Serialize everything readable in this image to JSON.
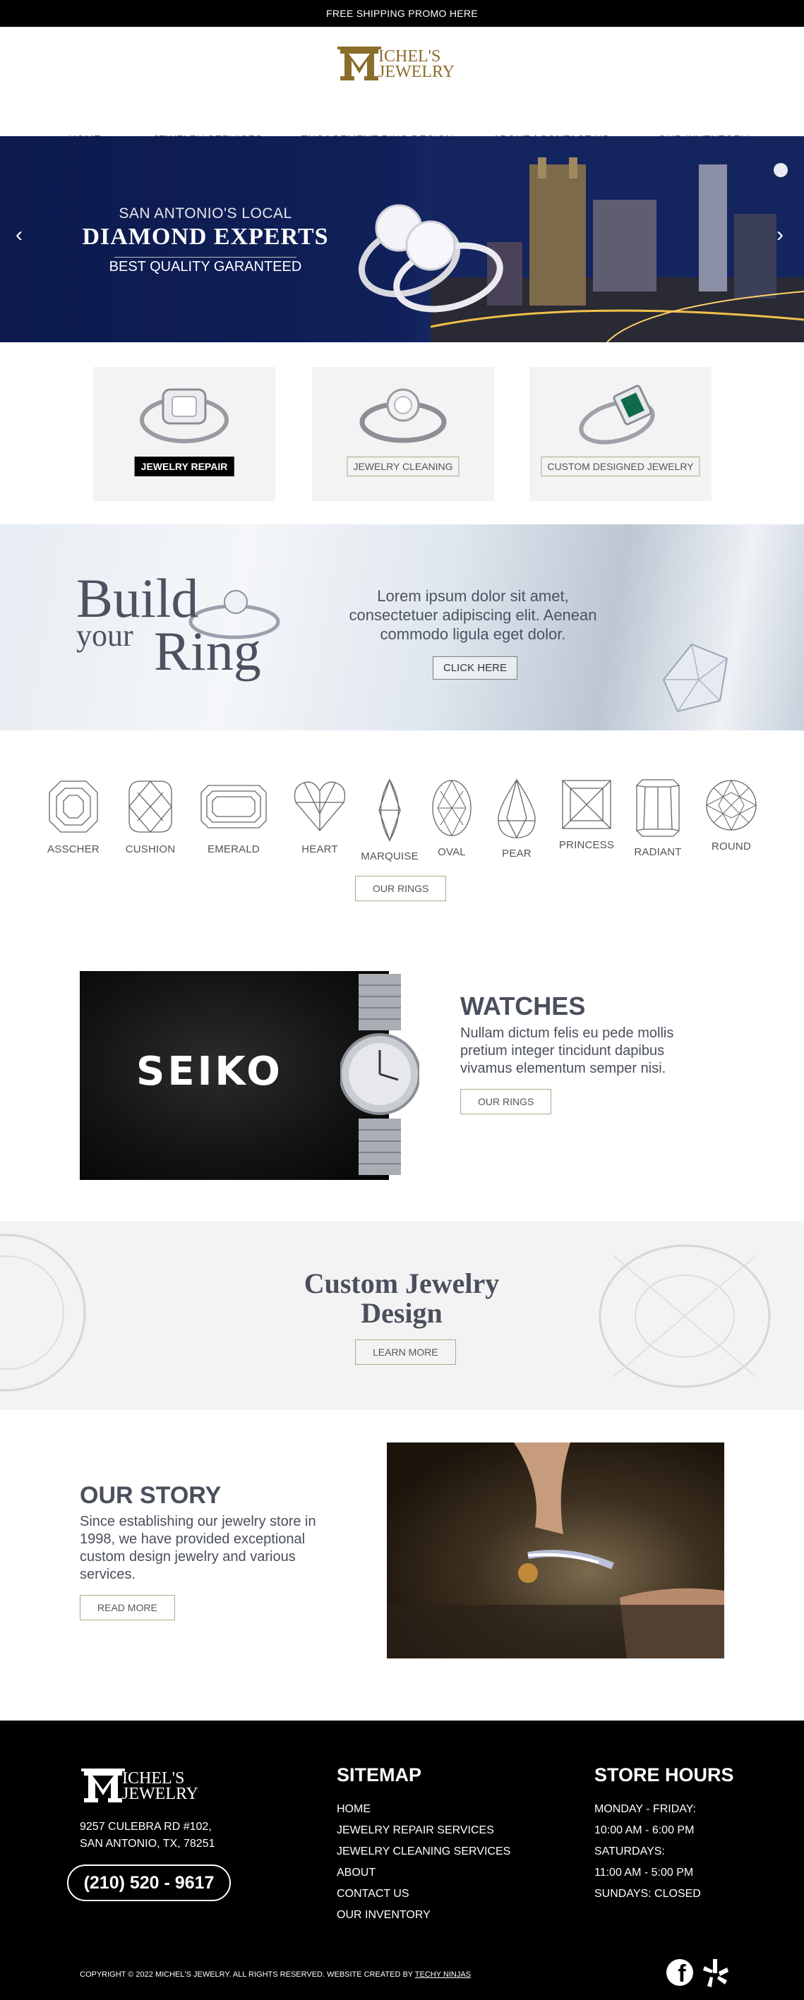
{
  "promo": {
    "text": "FREE SHIPPING PROMO HERE"
  },
  "logo": {
    "line1": "ICHEL'S",
    "line2": "JEWELRY"
  },
  "nav": [
    "HOME",
    "JEWELRY SERVICES",
    "ENGAGEMENT RING DESIGN",
    "ABOUT / CONTACT US",
    "OUR INVENTORY"
  ],
  "hero": {
    "line1": "SAN ANTONIO'S LOCAL",
    "line2": "DIAMOND EXPERTS",
    "line3": "BEST QUALITY GARANTEED",
    "prev_icon": "chevron-left-icon",
    "next_icon": "chevron-right-icon"
  },
  "services": [
    {
      "label": "JEWELRY REPAIR",
      "active": true
    },
    {
      "label": "JEWELRY CLEANING",
      "active": false
    },
    {
      "label": "CUSTOM DESIGNED JEWELRY",
      "active": false
    }
  ],
  "build": {
    "word1": "Build",
    "word2": "your",
    "word3": "Ring",
    "copy": "Lorem ipsum dolor sit amet, consectetuer adipiscing elit. Aenean commodo ligula eget dolor.",
    "button": "CLICK HERE"
  },
  "shapes": {
    "items": [
      "ASSCHER",
      "CUSHION",
      "EMERALD",
      "HEART",
      "MARQUISE",
      "OVAL",
      "PEAR",
      "PRINCESS",
      "RADIANT",
      "ROUND"
    ],
    "button": "OUR RINGS"
  },
  "watches": {
    "brand": "SEIKO",
    "title": "WATCHES",
    "copy": "Nullam dictum felis eu pede mollis pretium integer tincidunt dapibus vivamus elementum semper nisi.",
    "button": "OUR RINGS"
  },
  "custom": {
    "title": "Custom Jewelry Design",
    "button": "LEARN MORE"
  },
  "story": {
    "title": "OUR STORY",
    "copy": "Since establishing our jewelry store in 1998, we have provided exceptional custom design jewelry and various services.",
    "button": "READ MORE"
  },
  "footer": {
    "address1": "9257 CULEBRA RD #102,",
    "address2": "SAN ANTONIO, TX, 78251",
    "phone": "(210) 520 - 9617",
    "sitemap_title": "SITEMAP",
    "sitemap": [
      "HOME",
      "JEWELRY REPAIR SERVICES",
      "JEWELRY CLEANING SERVICES",
      "ABOUT",
      "CONTACT US",
      "OUR INVENTORY"
    ],
    "hours_title": "STORE HOURS",
    "hours": [
      "MONDAY - FRIDAY:",
      "10:00 AM - 6:00 PM",
      "SATURDAYS:",
      "11:00 AM - 5:00 PM",
      "SUNDAYS: CLOSED"
    ],
    "copyright": "COPYRIGHT © 2022 MICHEL'S JEWELRY. ALL RIGHTS RESERVED.  WEBSITE CREATED BY ",
    "credit": "TECHY NINJAS",
    "social": [
      "facebook-icon",
      "yelp-icon"
    ]
  },
  "colors": {
    "brand_gold": "#8b6d2b",
    "button_border": "#b3a78a",
    "heading_slate": "#4a4f5c",
    "hero_navy": "#0c1a4d"
  }
}
